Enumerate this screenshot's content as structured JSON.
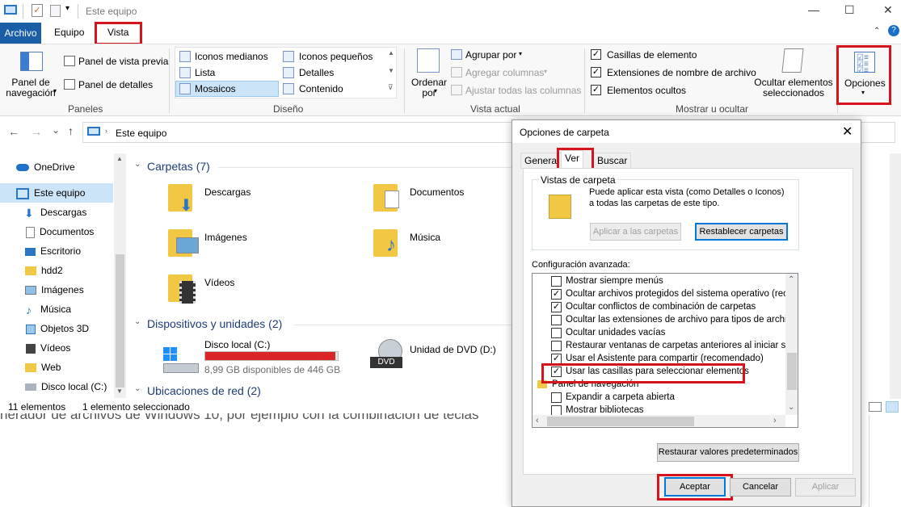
{
  "window": {
    "title": "Este equipo",
    "minimize": "—",
    "maximize": "☐",
    "close": "✕"
  },
  "tabs": {
    "file": "Archivo",
    "computer": "Equipo",
    "view": "Vista"
  },
  "ribbon": {
    "panes": {
      "nav_pane": "Panel de navegación",
      "preview_pane": "Panel de vista previa",
      "details_pane": "Panel de detalles",
      "group": "Paneles"
    },
    "layout": {
      "items": [
        "Iconos medianos",
        "Iconos pequeños",
        "Lista",
        "Detalles",
        "Mosaicos",
        "Contenido"
      ],
      "selected": "Mosaicos",
      "group": "Diseño"
    },
    "current_view": {
      "sort_by": "Ordenar por",
      "group_by": "Agrupar por",
      "add_columns": "Agregar columnas",
      "fit_columns": "Ajustar todas las columnas",
      "group": "Vista actual"
    },
    "show_hide": {
      "item_checkboxes": "Casillas de elemento",
      "file_extensions": "Extensiones de nombre de archivo",
      "hidden_items": "Elementos ocultos",
      "hide_selected": "Ocultar elementos seleccionados",
      "group": "Mostrar u ocultar"
    },
    "options": "Opciones"
  },
  "nav": {
    "back": "←",
    "forward": "→",
    "recent": "⌄",
    "up": "↑",
    "address": "Este equipo"
  },
  "sidebar": {
    "items": [
      "OneDrive",
      "Este equipo",
      "Descargas",
      "Documentos",
      "Escritorio",
      "hdd2",
      "Imágenes",
      "Música",
      "Objetos 3D",
      "Vídeos",
      "Web",
      "Disco local (C:)"
    ]
  },
  "content": {
    "folders_header": "Carpetas (7)",
    "folders": [
      "Descargas",
      "Documentos",
      "Imágenes",
      "Música",
      "Vídeos"
    ],
    "devices_header": "Dispositivos y unidades (2)",
    "local_disk": {
      "name": "Disco local (C:)",
      "free": "8,99 GB disponibles de 446 GB",
      "used_fraction": 0.98
    },
    "dvd": {
      "name": "Unidad de DVD (D:)",
      "label": "DVD"
    },
    "network_header": "Ubicaciones de red (2)"
  },
  "status": {
    "count": "11 elementos",
    "selected": "1 elemento seleccionado"
  },
  "background_text": "nerador de archivos de Windows 10, por ejemplo con la combinación de teclas",
  "dialog": {
    "title": "Opciones de carpeta",
    "tabs": [
      "General",
      "Ver",
      "Buscar"
    ],
    "folder_views": {
      "legend": "Vistas de carpeta",
      "description": "Puede aplicar esta vista (como Detalles o Iconos) a todas las carpetas de este tipo.",
      "apply_button": "Aplicar a las carpetas",
      "reset_button": "Restablecer carpetas"
    },
    "advanced_label": "Configuración avanzada:",
    "settings": [
      {
        "label": "Mostrar siempre menús",
        "checked": false
      },
      {
        "label": "Ocultar archivos protegidos del sistema operativo (recome",
        "checked": true
      },
      {
        "label": "Ocultar conflictos de combinación de carpetas",
        "checked": true
      },
      {
        "label": "Ocultar las extensiones de archivo para tipos de archivo c",
        "checked": false
      },
      {
        "label": "Ocultar unidades vacías",
        "checked": false
      },
      {
        "label": "Restaurar ventanas de carpetas anteriores al iniciar sesió",
        "checked": false
      },
      {
        "label": "Usar el Asistente para compartir (recomendado)",
        "checked": true
      },
      {
        "label": "Usar las casillas para seleccionar elementos",
        "checked": true
      },
      {
        "label": "Panel de navegación",
        "checked": null
      },
      {
        "label": "Expandir a carpeta abierta",
        "checked": false
      },
      {
        "label": "Mostrar bibliotecas",
        "checked": false
      }
    ],
    "restore_defaults": "Restaurar valores predeterminados",
    "ok": "Aceptar",
    "cancel": "Cancelar",
    "apply": "Aplicar"
  }
}
